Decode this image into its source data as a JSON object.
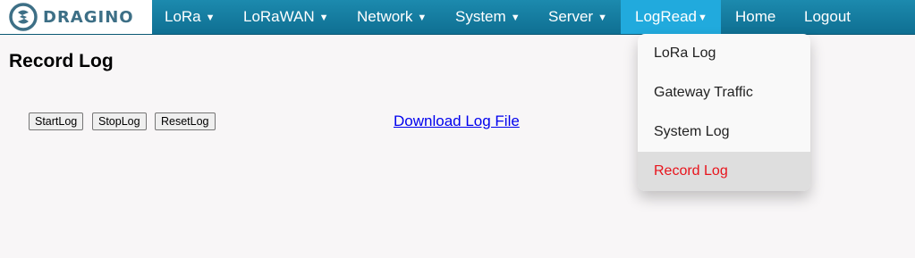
{
  "brand": {
    "name": "DRAGINO",
    "logo_icon": "dragino-logo-icon"
  },
  "nav": {
    "items": [
      {
        "label": "LoRa",
        "caret": "▼"
      },
      {
        "label": "LoRaWAN",
        "caret": "▼"
      },
      {
        "label": "Network",
        "caret": "▼"
      },
      {
        "label": "System",
        "caret": "▼"
      },
      {
        "label": "Server",
        "caret": "▼"
      },
      {
        "label": "LogRead",
        "caret": "▼"
      },
      {
        "label": "Home"
      },
      {
        "label": "Logout"
      }
    ],
    "active": "LogRead"
  },
  "page": {
    "title": "Record Log"
  },
  "controls": {
    "start_label": "StartLog",
    "stop_label": "StopLog",
    "reset_label": "ResetLog",
    "download_label": "Download Log File"
  },
  "dropdown": {
    "items": [
      {
        "label": "LoRa Log"
      },
      {
        "label": "Gateway Traffic"
      },
      {
        "label": "System Log"
      },
      {
        "label": "Record Log"
      }
    ],
    "current": "Record Log"
  },
  "colors": {
    "navbar": "#1c8aae",
    "nav_active": "#21aadd",
    "current_item": "#e8141c",
    "link": "#0000ee"
  }
}
